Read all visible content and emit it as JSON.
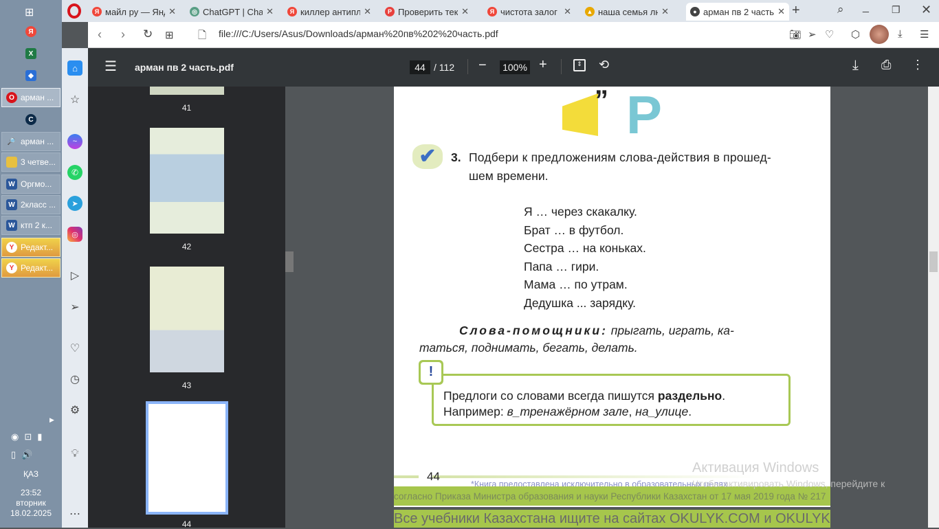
{
  "taskbar": {
    "items": [
      {
        "label": "арман ...",
        "icon": "opera-icon",
        "active": true
      },
      {
        "label": "арман ...",
        "icon": "search-magnifier-icon"
      },
      {
        "label": "3 четве...",
        "icon": "folder-icon"
      },
      {
        "label": "Оргмо...",
        "icon": "word-icon"
      },
      {
        "label": "2класс ...",
        "icon": "word-icon"
      },
      {
        "label": "ктп 2 к...",
        "icon": "word-icon"
      },
      {
        "label": "Редакт...",
        "icon": "yandex-browser-icon"
      },
      {
        "label": "Редакт...",
        "icon": "yandex-browser-icon"
      }
    ],
    "lang": "ҚАЗ",
    "time": "23:52",
    "weekday": "вторник",
    "date": "18.02.2025"
  },
  "tabs": [
    {
      "title": "майл ру — Яндекс",
      "icon": "Я",
      "color": "#f0473a"
    },
    {
      "title": "ChatGPT | ChatGPT",
      "icon": "◎",
      "color": "#5a9f86"
    },
    {
      "title": "киллер антиплагиат",
      "icon": "Я",
      "color": "#f0473a"
    },
    {
      "title": "Проверить текст",
      "icon": "P",
      "color": "#e8413d"
    },
    {
      "title": "чистота залог здоровья",
      "icon": "Я",
      "color": "#f0473a"
    },
    {
      "title": "наша семья любимая",
      "icon": "▲",
      "color": "#e8a800"
    },
    {
      "title": "арман пв 2 часть",
      "icon": "●",
      "color": "#444",
      "active": true
    }
  ],
  "address": {
    "url": "file:///C:/Users/Asus/Downloads/арман%20пв%202%20часть.pdf"
  },
  "pdf": {
    "filename": "арман пв 2 часть.pdf",
    "page": "44",
    "total": "/ 112",
    "zoom": "100%",
    "thumbs": [
      "41",
      "42",
      "43",
      "44"
    ]
  },
  "page": {
    "task_num": "3.",
    "task_line1": "Подбери к предложениям слова-действия в прошед-",
    "task_line2": "шем времени.",
    "sentences": [
      "Я … через скакалку.",
      "Брат … в футбол.",
      "Сестра … на коньках.",
      "Папа … гири.",
      "Мама … по утрам.",
      "Дедушка ... зарядку."
    ],
    "helpers_label": "Слова-помощники:",
    "helpers_1": " прыгать, играть, ка-",
    "helpers_2": "таться, поднимать, бегать, делать.",
    "rule_1a": "Предлоги со словами всегда пишутся ",
    "rule_1b": "раздельно",
    "rule_2a": "Например: ",
    "rule_2b": "в_тренажёрном зале",
    "rule_2c": ", ",
    "rule_2d": "на_улице",
    "page_number": "44",
    "footnote_1": "*Книга предоставлена исключительно в образовательных целях",
    "footnote_2": "согласно Приказа Министра образования и науки Республики Казахстан от 17 мая 2019 года № 217",
    "banner": "Все учебники Казахстана ищите на сайтах OKULYK.COM и OKULYK.KZ"
  },
  "watermark": {
    "title": "Активация Windows",
    "text": "Чтобы активировать Windows, перейдите к"
  }
}
